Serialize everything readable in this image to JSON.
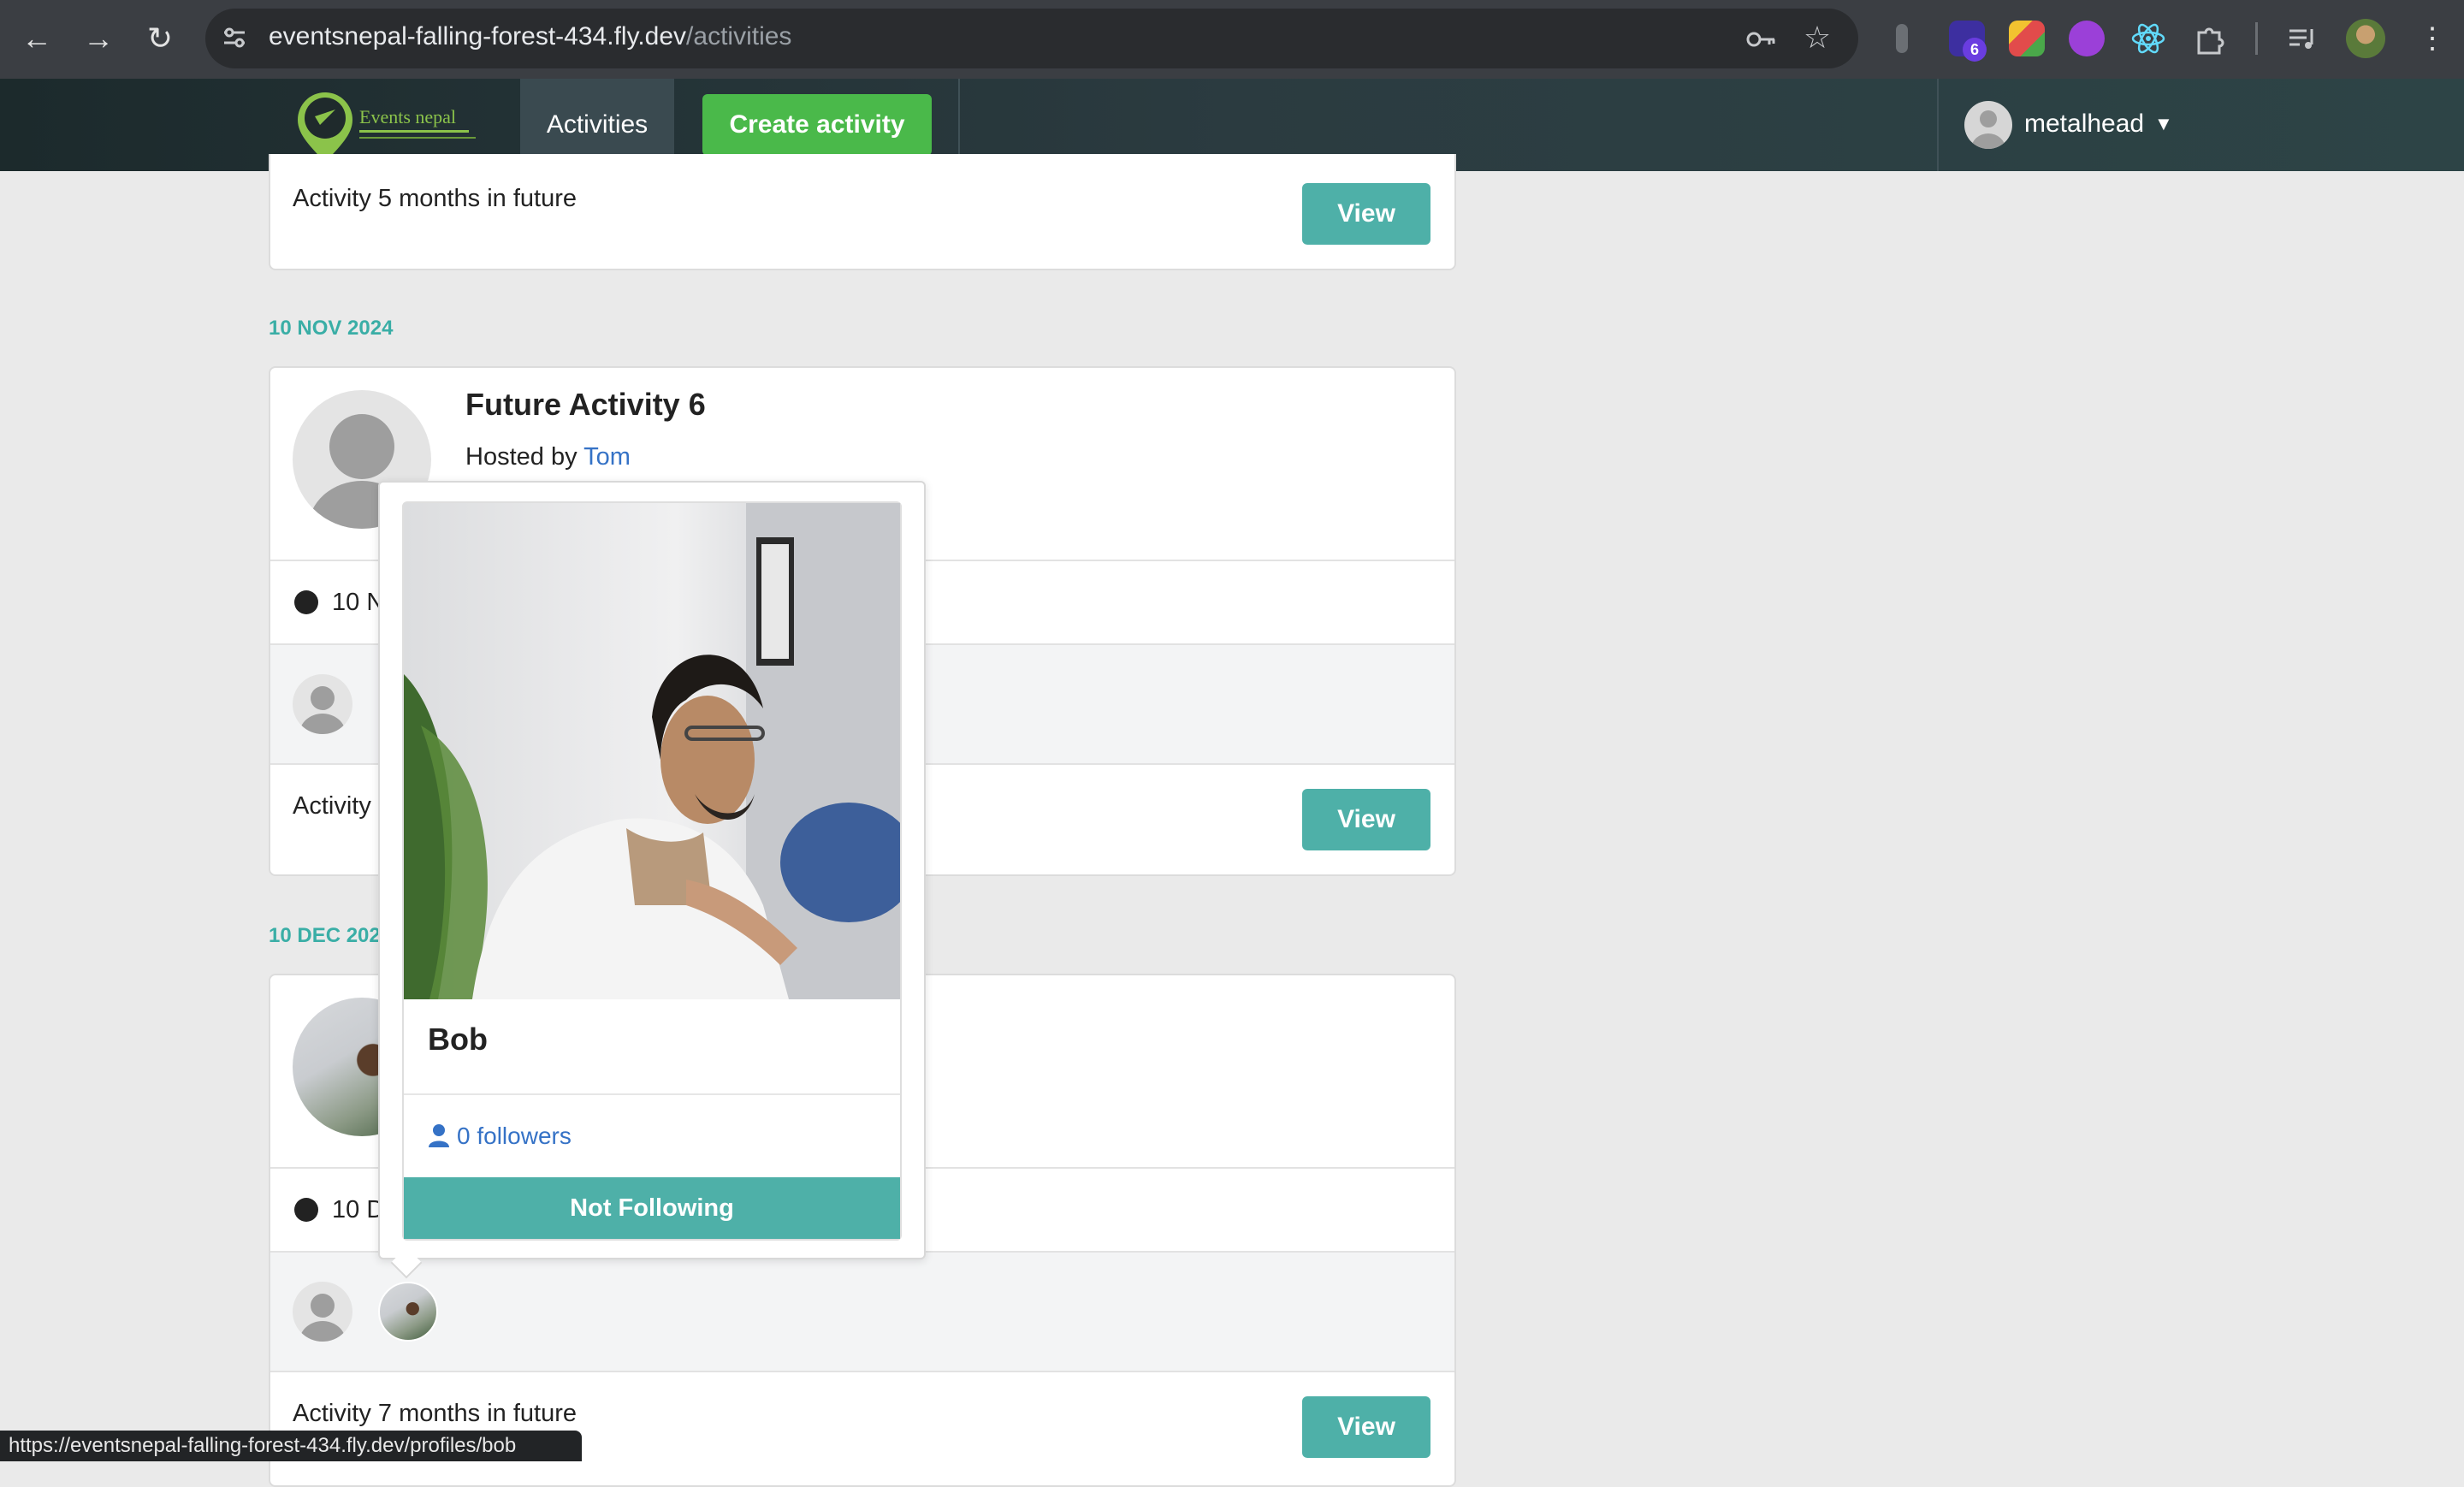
{
  "browser": {
    "url_host": "eventsnepal-falling-forest-434.fly.dev",
    "url_path": "/activities",
    "extension_badge": "6"
  },
  "navbar": {
    "logo_text": "Events nepal",
    "activities_label": "Activities",
    "create_activity_label": "Create activity",
    "username": "metalhead"
  },
  "activities": [
    {
      "description": "Activity 5 months in future",
      "view_label": "View"
    },
    {
      "date_header": "10 NOV 2024",
      "title": "Future Activity 6",
      "hosted_by_prefix": "Hosted by ",
      "host": "Tom",
      "date_text": "10 N",
      "description": "Activity",
      "view_label": "View"
    },
    {
      "date_header": "10 DEC 202",
      "date_text": "10 D",
      "description": "Activity 7 months in future",
      "view_label": "View"
    }
  ],
  "profile_popover": {
    "name": "Bob",
    "followers": "0 followers",
    "follow_status": "Not Following"
  },
  "status_bar": {
    "url": "https://eventsnepal-falling-forest-434.fly.dev/profiles/bob"
  },
  "colors": {
    "accent_teal": "#4eb0a8",
    "create_green": "#4ab94a",
    "link_blue": "#3572c6",
    "date_header_teal": "#3aaea6"
  }
}
